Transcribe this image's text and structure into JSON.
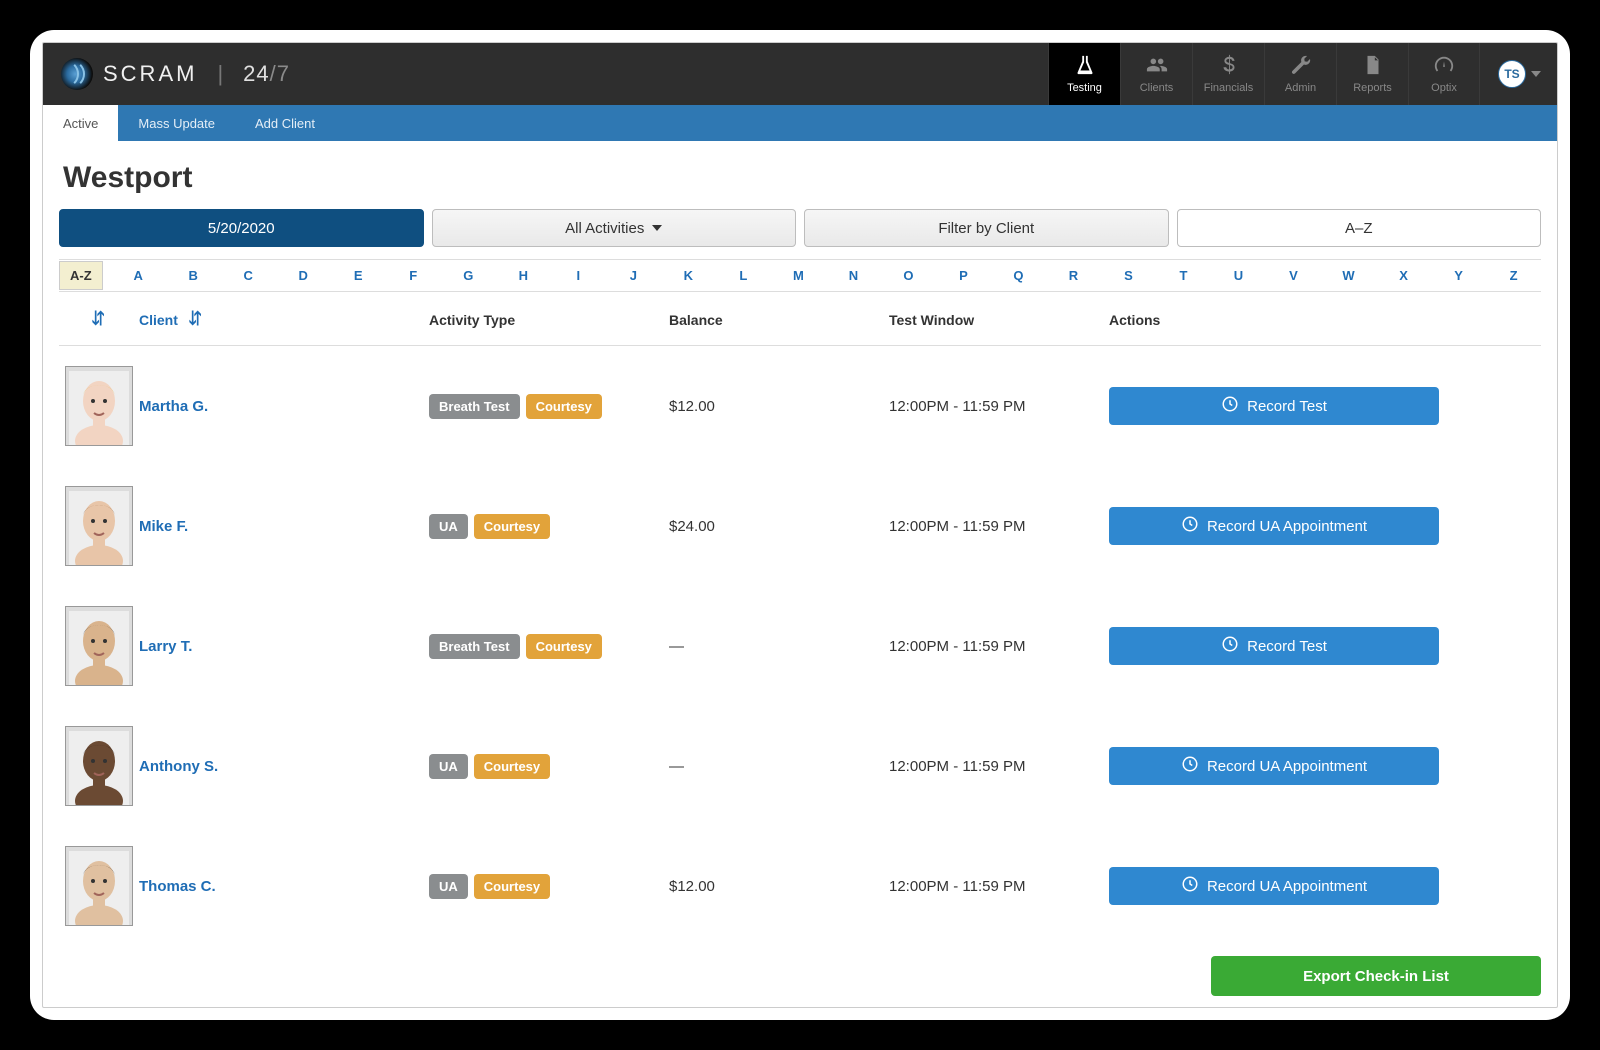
{
  "brand": {
    "name": "SCRAM",
    "sub1": "24",
    "sub2": "/7"
  },
  "topnav": [
    {
      "label": "Testing",
      "icon": "flask",
      "active": true
    },
    {
      "label": "Clients",
      "icon": "users",
      "active": false
    },
    {
      "label": "Financials",
      "icon": "dollar",
      "active": false
    },
    {
      "label": "Admin",
      "icon": "wrench",
      "active": false
    },
    {
      "label": "Reports",
      "icon": "document",
      "active": false
    },
    {
      "label": "Optix",
      "icon": "gauge",
      "active": false
    }
  ],
  "user": {
    "initials": "TS"
  },
  "subnav": [
    {
      "label": "Active",
      "active": true
    },
    {
      "label": "Mass Update",
      "active": false
    },
    {
      "label": "Add Client",
      "active": false
    }
  ],
  "page_title": "Westport",
  "filters": {
    "date": "5/20/2020",
    "activities": "All Activities",
    "filter_client": "Filter by Client",
    "sort": "A–Z"
  },
  "alpha_all": "A-Z",
  "alpha": [
    "A",
    "B",
    "C",
    "D",
    "E",
    "F",
    "G",
    "H",
    "I",
    "J",
    "K",
    "L",
    "M",
    "N",
    "O",
    "P",
    "Q",
    "R",
    "S",
    "T",
    "U",
    "V",
    "W",
    "X",
    "Y",
    "Z"
  ],
  "columns": {
    "client": "Client",
    "activity": "Activity Type",
    "balance": "Balance",
    "window": "Test Window",
    "actions": "Actions"
  },
  "action_labels": {
    "record_test": "Record Test",
    "record_ua": "Record UA Appointment"
  },
  "export_label": "Export Check-in List",
  "rows": [
    {
      "name": "Martha G.",
      "tags": [
        "Breath Test",
        "Courtesy"
      ],
      "tag1_class": "tag-grey",
      "tag1": "Breath Test",
      "tag2": "Courtesy",
      "balance": "$12.00",
      "window": "12:00PM - 11:59 PM",
      "action": "record_test",
      "avatar_skin": "#f2d4c2",
      "avatar_hair": "#e6c26a"
    },
    {
      "name": "Mike F.",
      "tags": [
        "UA",
        "Courtesy"
      ],
      "tag1_class": "tag-grey",
      "tag1": "UA",
      "tag2": "Courtesy",
      "balance": "$24.00",
      "window": "12:00PM - 11:59 PM",
      "action": "record_ua",
      "avatar_skin": "#e8c5a8",
      "avatar_hair": "#8a5a32"
    },
    {
      "name": "Larry T.",
      "tags": [
        "Breath Test",
        "Courtesy"
      ],
      "tag1_class": "tag-grey",
      "tag1": "Breath Test",
      "tag2": "Courtesy",
      "balance": "—",
      "window": "12:00PM - 11:59 PM",
      "action": "record_test",
      "avatar_skin": "#d9b38c",
      "avatar_hair": "#1b1b1b"
    },
    {
      "name": "Anthony S.",
      "tags": [
        "UA",
        "Courtesy"
      ],
      "tag1_class": "tag-grey",
      "tag1": "UA",
      "tag2": "Courtesy",
      "balance": "—",
      "window": "12:00PM - 11:59 PM",
      "action": "record_ua",
      "avatar_skin": "#6b4a33",
      "avatar_hair": "#1a1410"
    },
    {
      "name": "Thomas C.",
      "tags": [
        "UA",
        "Courtesy"
      ],
      "tag1_class": "tag-grey",
      "tag1": "UA",
      "tag2": "Courtesy",
      "balance": "$12.00",
      "window": "12:00PM - 11:59 PM",
      "action": "record_ua",
      "avatar_skin": "#e0c0a0",
      "avatar_hair": "#3b2a1a"
    }
  ]
}
